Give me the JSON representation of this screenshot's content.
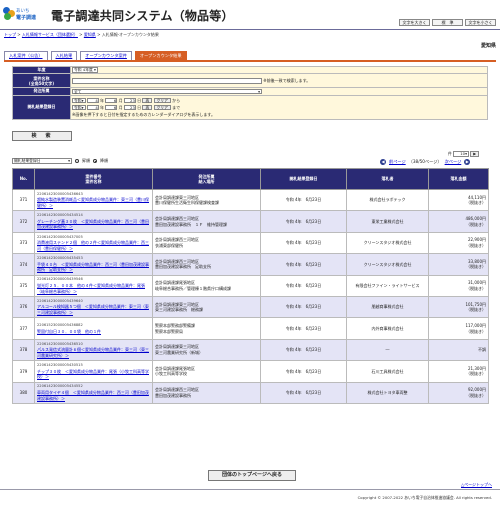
{
  "header": {
    "logo_line1": "あいち",
    "logo_line2": "電子調達",
    "title": "電子調達共同システム（物品等）",
    "font_buttons": [
      "文字を大きく",
      "標　準",
      "文字を小さく"
    ]
  },
  "breadcrumb": {
    "items": [
      "トップ",
      "入札情報サービス（団体選択）",
      "愛知県",
      "入札情報-オープンカウンタ結果"
    ],
    "separator": " > "
  },
  "org": "愛知県",
  "tabs": [
    "入札案件（公告）",
    "入札結果",
    "オープンカウンタ案件",
    "オープンカウンタ結果"
  ],
  "form": {
    "rows": [
      {
        "label": "年度",
        "select": "令和 4年度"
      },
      {
        "label": "案件名称\n(全角50文字)",
        "note": "※前後一致で検索します。"
      },
      {
        "label": "発注所属",
        "select": "全て"
      },
      {
        "label": "開札結果登録日",
        "lines": [
          {
            "era": "令和",
            "y": "4",
            "m": "6",
            "d": "23",
            "btn1": "再",
            "btn2": "クリア",
            "tail": "から"
          },
          {
            "era": "令和",
            "y": "4",
            "m": "6",
            "d": "23",
            "btn1": "再",
            "btn2": "クリア",
            "tail": "まで"
          }
        ],
        "note": "※画像を押下すると日付を指定するためのカレンダーダイアログを表示します。"
      }
    ]
  },
  "search_button": "検　索",
  "list": {
    "page_size": "10",
    "page_size_suffix": "件",
    "sort_select": "開札結果登録日",
    "asc": "昇順",
    "desc": "降順",
    "prev": "前ページ",
    "page_info": "（38/50ページ）",
    "next": "次ページ",
    "headers": [
      "No.",
      "案件番号\n案件名称",
      "発注所属\n納入場所",
      "開札結果登録日",
      "落札者",
      "落札金額"
    ],
    "rows": [
      {
        "no": "371",
        "id": "22061423000005436643",
        "name": "超純水製造装置消耗品＜愛知県成分物品業件：東三河（豊川保健所）＞",
        "dept": "会計局調達課東三河地区",
        "place": "豊川保健所生活衛生科保健課検査課",
        "date": "令和 4年　6月23日",
        "winner": "株式会社ラボテック",
        "amount": "44,110円",
        "tax": "（税抜き）"
      },
      {
        "no": "372",
        "id": "22061423000005434514",
        "name": "グレーチング蓋３０枚　＜愛知県成分物品業件：西三河（豊田加茂建設事務所）＞",
        "dept": "会計局調達課西三河地区",
        "place": "豊田加茂建設事務所　１Ｆ　維持管理課",
        "date": "令和 4年　6月23日",
        "winner": "東栄工業株式会社",
        "amount": "486,000円",
        "tax": "（税抜き）"
      },
      {
        "no": "373",
        "id": "22061423000005437005",
        "name": "消費液用ステンド２個　他の２件＜愛知県成分物品業件：西三河（豊田保健所）＞",
        "dept": "会計局調達課西三河地区",
        "place": "衣浦東部保健所",
        "date": "令和 4年　6月23日",
        "winner": "クリーンスタジオ株式会社",
        "amount": "22,900円",
        "tax": "（税抜き）"
      },
      {
        "no": "374",
        "id": "22061423000005435453",
        "name": "手袋４０台　＜愛知県成分物品業件：西三河（豊田加茂建設事務所　足助支所）＞",
        "dept": "会計局調達課西三河地区",
        "place": "豊田加茂建設事務所　足助支所",
        "date": "令和 4年　6月23日",
        "winner": "クリーンスタジオ株式会社",
        "amount": "33,800円",
        "tax": "（税抜き）"
      },
      {
        "no": "375",
        "id": "22061423000005439546",
        "name": "蛍光灯２５．００本　他の４件＜愛知県成分物品業件：尾張（岐阜総合事務所）＞",
        "dept": "会計局調達課尾張地区",
        "place": "岐阜総合事務所／管理棟１階県庁口構成課",
        "date": "令和 4年　6月23日",
        "winner": "有限会社ファイン・ライトサービス",
        "amount": "31,000円",
        "tax": "（税抜き）"
      },
      {
        "no": "376",
        "id": "22061423000005439640",
        "name": "アルコール検知器５つ個　＜愛知県成分物品業件：東三河（東三河建設事務所）＞",
        "dept": "会計局調達課東三河地区",
        "place": "東三河建設事務所　総務課",
        "date": "令和 4年　6月23日",
        "winner": "朋越商事株式会社",
        "amount": "101,750円",
        "tax": "（税抜き）"
      },
      {
        "no": "377",
        "id": "22061523000005436882",
        "name": "警固付自日３０．００袋　他の１件",
        "dept": "警察本部警務部警備課",
        "place": "警察本部警察局",
        "date": "令和 4年　6月23日",
        "winner": "内外商事株式会社",
        "amount": "117,000円",
        "tax": "（税抜き）"
      },
      {
        "no": "378",
        "id": "22061423000005436510",
        "name": "パルス発信式流量計６個＜愛知県成分物品業件：東三河（東三河農業研究所）＞",
        "dept": "会計局調達課東三河地区",
        "place": "東三河農業研究所（新城）",
        "date": "令和 4年　6月23日",
        "winner": "―",
        "amount": "不調",
        "tax": ""
      },
      {
        "no": "379",
        "id": "22061423000005430515",
        "name": "チップ３０枚　＜愛知県成分物品業件：尾張（小牧工科高等学校）＞",
        "dept": "会計局調達課尾張地区",
        "place": "小牧工科高等学校",
        "date": "令和 4年　6月23日",
        "winner": "石川工具株式会社",
        "amount": "21,300円",
        "tax": "（税抜き）"
      },
      {
        "no": "380",
        "id": "22061423000005434552",
        "name": "車両用タイヤ４個　＜愛知県成分物品業件：西三河（豊田加茂建設事務所）＞",
        "dept": "会計局調達課西三河地区",
        "place": "豊田加茂建設事務所",
        "date": "令和 4年　6月23日",
        "winner": "株式会社トヨタ車両整",
        "amount": "92,000円",
        "tax": "（税抜き）"
      }
    ]
  },
  "back_button": "団体のトップページへ戻る",
  "to_top": "△ページトップへ",
  "footer": "Copyright © 2007-2022 あいち電子自治体推進協議会. All rights reserved."
}
